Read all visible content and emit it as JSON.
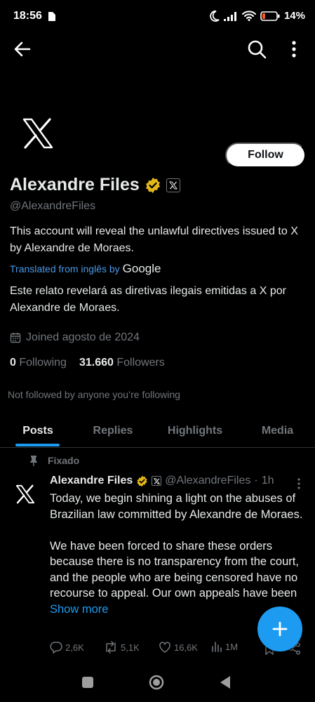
{
  "status_bar": {
    "time": "18:56",
    "battery_text": "14%",
    "icons": [
      "sim-icon",
      "moon-icon",
      "signal-icon",
      "wifi-icon",
      "battery-icon"
    ]
  },
  "top_bar": {
    "icons": [
      "back-arrow-icon",
      "search-icon",
      "more-vertical-icon"
    ]
  },
  "profile": {
    "name": "Alexandre Files",
    "handle": "@AlexandreFiles",
    "follow_label": "Follow",
    "bio": "This account will reveal the unlawful directives issued to X by Alexandre de Moraes.",
    "translated_label": "Translated from inglês by",
    "translated_brand": "Google",
    "bio_translated": "Este relato revelará as diretivas ilegais emitidas a X por Alexandre de Moraes.",
    "joined": "Joined agosto de 2024",
    "following_count": "0",
    "following_label": "Following",
    "followers_count": "31.660",
    "followers_label": "Followers",
    "not_followed": "Not followed by anyone you’re following"
  },
  "tabs": [
    {
      "label": "Posts",
      "active": true
    },
    {
      "label": "Replies",
      "active": false
    },
    {
      "label": "Highlights",
      "active": false
    },
    {
      "label": "Media",
      "active": false
    }
  ],
  "pinned_tweet": {
    "pinned_label": "Fixado",
    "author_name": "Alexandre Files",
    "author_handle": "@AlexandreFiles",
    "separator": "·",
    "time": "1h",
    "text": "Today, we begin shining a light on the abuses of Brazilian law committed by Alexandre de Moraes.\n\nWe have been forced to share these orders because there is no transparency from the court, and the people who are being censored have no recourse to appeal. Our own appeals have been ",
    "show_more": "Show more",
    "replies": "2,6K",
    "reposts": "5,1K",
    "likes": "16,6K",
    "views": "1M"
  },
  "colors": {
    "background": "#000000",
    "accent": "#1d9bf0",
    "verified_gold": "#e2b719",
    "muted_text": "#71767b",
    "translated_link": "#4a99e9"
  }
}
